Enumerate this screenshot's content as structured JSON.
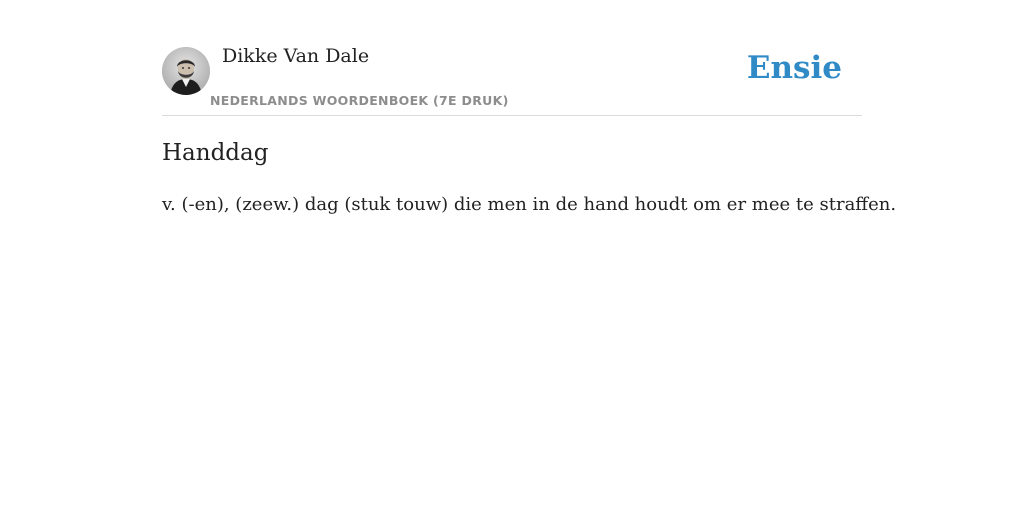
{
  "author": {
    "name": "Dikke Van Dale",
    "avatar_icon": "portrait-avatar",
    "source": "NEDERLANDS WOORDENBOEK (7E DRUK)"
  },
  "brand": {
    "label": "Ensie",
    "color": "#2f8ac6"
  },
  "entry": {
    "term": "Handdag",
    "definition": "v. (-en), (zeew.) dag (stuk touw) die men in de hand houdt om er mee te straffen."
  }
}
